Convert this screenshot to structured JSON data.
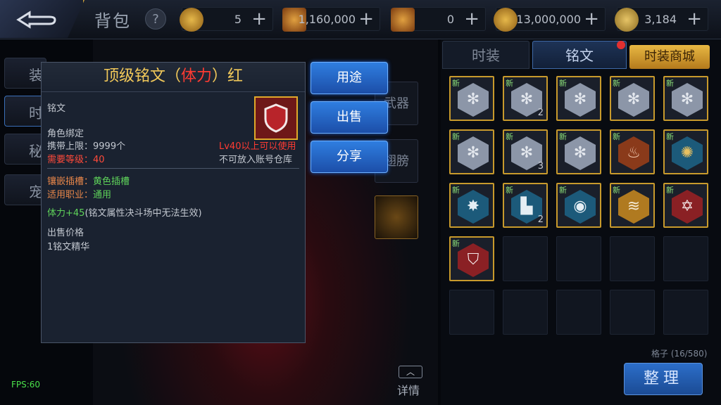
{
  "header": {
    "title": "背包",
    "help": "?",
    "currencies": [
      {
        "value": "5",
        "plus": "+",
        "icon": "gold-coin-icon"
      },
      {
        "value": "1,160,000",
        "plus": "+",
        "icon": "scroll-icon"
      },
      {
        "value": "0",
        "plus": "+",
        "icon": "scroll-icon"
      },
      {
        "value": "13,000,000",
        "plus": "+",
        "icon": "gold-coin-icon"
      },
      {
        "value": "3,184",
        "plus": "+",
        "icon": "medal-icon"
      }
    ]
  },
  "left_nav": [
    "装",
    "时",
    "秘",
    "宠"
  ],
  "center": {
    "slot_weapon": "武器",
    "slot_wings": "翅膀",
    "details_label": "详情"
  },
  "detail": {
    "title_prefix": "顶级铭文（",
    "title_attr": "体力",
    "title_suffix": "）红",
    "type": "铭文",
    "binding": "角色绑定",
    "carry_limit": "携带上限：9999个",
    "req_level": "需要等级：40",
    "lv_notice": "Lv40以上可以使用",
    "no_warehouse": "不可放入账号仓库",
    "socket_label": "镶嵌插槽：",
    "socket_value": "黄色插槽",
    "job_label": "适用职业：",
    "job_value": "通用",
    "bonus": "体力+45",
    "bonus_note": "(铭文属性决斗场中无法生效)",
    "price_label": "出售价格",
    "price_value": "1铭文精华"
  },
  "actions": [
    "用途",
    "出售",
    "分享"
  ],
  "right": {
    "tab_fashion": "时装",
    "tab_inscription": "铭文",
    "tab_shop": "时装商城",
    "new_badge": "新",
    "grid_count": "格子 (16/580)",
    "sort_label": "整理"
  },
  "fps": "FPS:60",
  "colors": {
    "gold": "#f2c95a",
    "red": "#ff3b32",
    "green": "#5fd35a",
    "accent_blue": "#2f7ee0"
  }
}
